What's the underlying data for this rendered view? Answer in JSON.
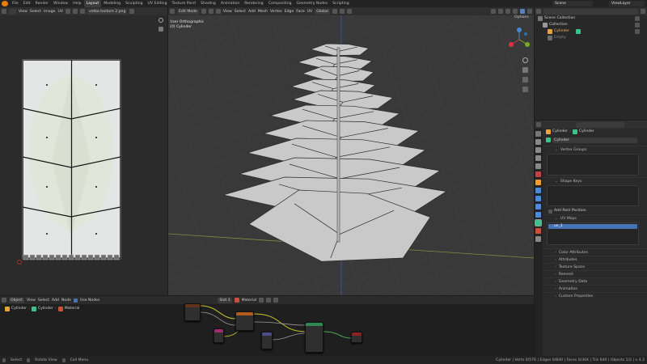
{
  "topbar": {
    "menus": [
      "File",
      "Edit",
      "Render",
      "Window",
      "Help"
    ],
    "workspaces": [
      "Layout",
      "Modeling",
      "Sculpting",
      "UV Editing",
      "Texture Paint",
      "Shading",
      "Animation",
      "Rendering",
      "Compositing",
      "Geometry Nodes",
      "Scripting"
    ],
    "scene": "Scene",
    "view_layer": "ViewLayer"
  },
  "uv_editor": {
    "menus": [
      "View",
      "Select",
      "Image",
      "UV"
    ],
    "image_name": "vetka texture 2.png"
  },
  "viewport": {
    "mode": "Edit Mode",
    "menus": [
      "View",
      "Select",
      "Add",
      "Mesh",
      "Vertex",
      "Edge",
      "Face",
      "UV"
    ],
    "transform": "Global",
    "options": "Options",
    "overlay_title": "User Orthographic",
    "overlay_object": "(0) Cylinder"
  },
  "outliner": {
    "collection": "Scene Collection",
    "items": [
      {
        "label": "Collection"
      },
      {
        "label": "Cylinder"
      },
      {
        "label": "Empty"
      }
    ]
  },
  "properties": {
    "breadcrumb_object": "Cylinder",
    "breadcrumb_data": "Cylinder",
    "data_name": "Cylinder",
    "sections": {
      "vertex_groups": "Vertex Groups",
      "shape_keys": "Shape Keys",
      "add_rest_position": "Add Rest Position",
      "uv_maps": "UV Maps",
      "uv_map_name": "uv_1",
      "color_attributes": "Color Attributes",
      "attributes": "Attributes",
      "texture_space": "Texture Space",
      "remesh": "Remesh",
      "geometry_data": "Geometry Data",
      "animation": "Animation",
      "custom_properties": "Custom Properties"
    }
  },
  "node_editor": {
    "mode": "Object",
    "menus": [
      "View",
      "Select",
      "Add",
      "Node"
    ],
    "use_nodes": "Use Nodes",
    "slot": "Slot 3",
    "material": "Material",
    "breadcrumb": [
      "Cylinder",
      "Cylinder",
      "Material"
    ]
  },
  "status": {
    "items": [
      "Select",
      "Rotate View",
      "Call Menu"
    ],
    "stats": "Cylinder | Verts 0/576 | Edges 0/840 | Faces 0/304 | Tris 640 | Objects 1/2 | v 4.2"
  },
  "colors": {
    "accent": "#e87d0d",
    "selected": "#4772b3"
  }
}
